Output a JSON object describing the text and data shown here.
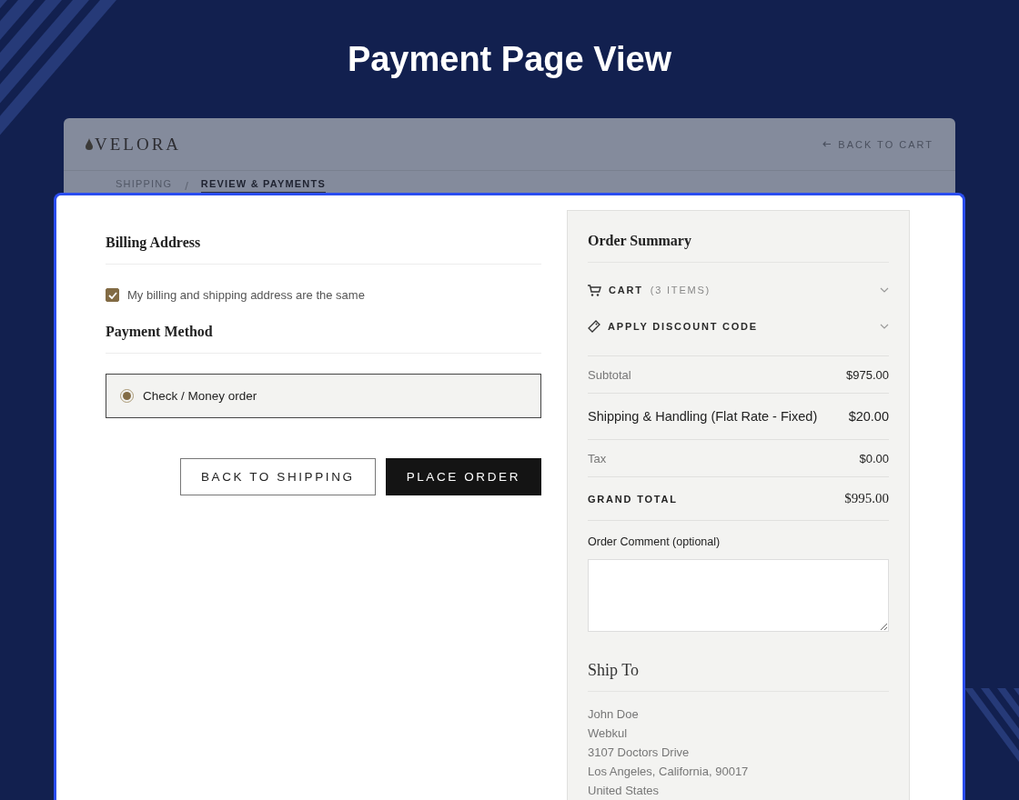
{
  "page_title": "Payment Page View",
  "store_header": {
    "logo": "VELORA",
    "back_link": "BACK TO CART"
  },
  "steps": [
    {
      "label": "SHIPPING",
      "selected": false
    },
    {
      "label": "REVIEW & PAYMENTS",
      "selected": true
    }
  ],
  "step_separator": "/",
  "billing": {
    "title": "Billing Address",
    "same_address": {
      "label": "My billing and shipping address are the same",
      "checked": true
    }
  },
  "payment": {
    "title": "Payment Method",
    "options": [
      {
        "label": "Check / Money order",
        "selected": true
      }
    ]
  },
  "actions": [
    {
      "kind": "secondary",
      "label": "BACK TO SHIPPING"
    },
    {
      "kind": "primary",
      "label": "PLACE ORDER"
    }
  ],
  "summary": {
    "title": "Order Summary",
    "sections": [
      {
        "kind": "cart",
        "label": "CART",
        "count": "(3 ITEMS)",
        "expanded": false
      },
      {
        "kind": "discount",
        "label": "APPLY DISCOUNT CODE",
        "expanded": false
      }
    ],
    "totals": [
      {
        "kind": "normal",
        "label": "Subtotal",
        "value": "$975.00"
      },
      {
        "kind": "shipping",
        "label": "Shipping & Handling (Flat Rate - Fixed)",
        "value": "$20.00"
      },
      {
        "kind": "normal",
        "label": "Tax",
        "value": "$0.00"
      },
      {
        "kind": "grand",
        "label": "GRAND TOTAL",
        "value": "$995.00"
      }
    ],
    "comment_label": "Order Comment (optional)",
    "ship_to": {
      "title": "Ship To",
      "lines": [
        "John Doe",
        "Webkul",
        "3107 Doctors Drive",
        "Los Angeles, California, 90017",
        "United States"
      ]
    }
  }
}
